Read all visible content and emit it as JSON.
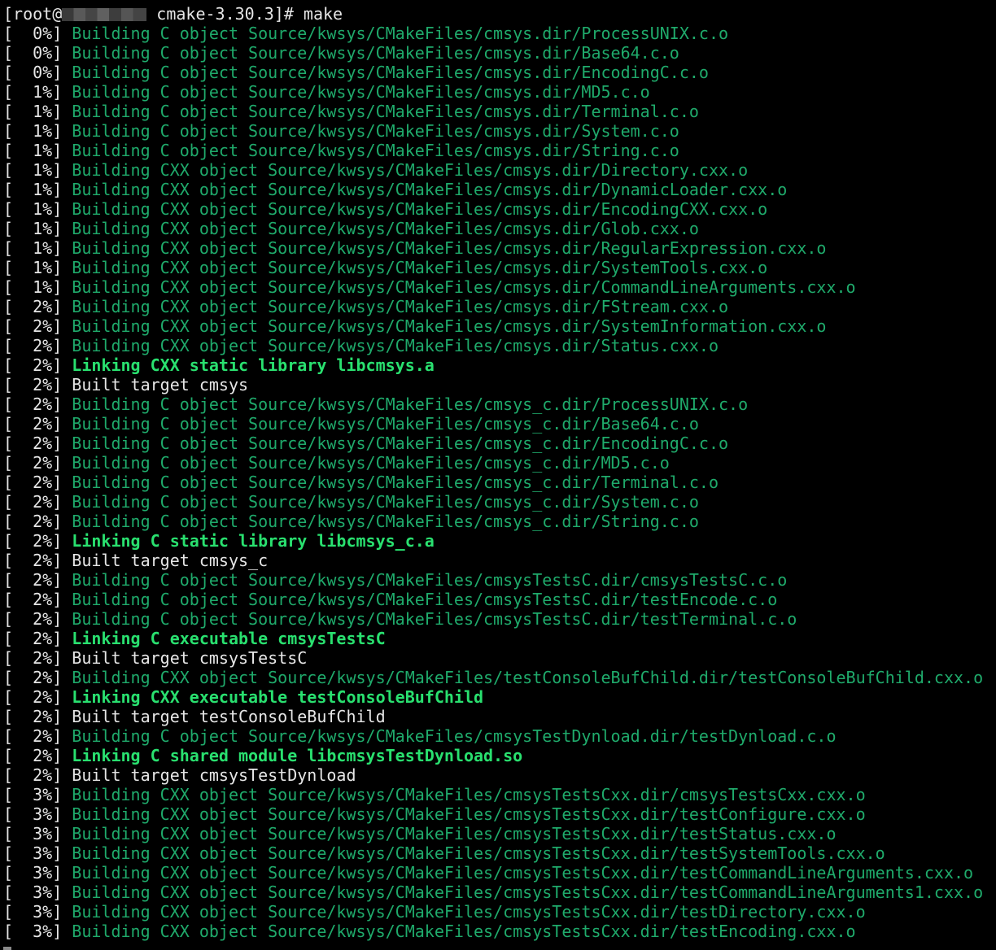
{
  "terminal": {
    "prompt": {
      "prefix": "[root@",
      "host_masked": "",
      "suffix": " cmake-3.30.3]# make"
    },
    "lines": [
      {
        "pct": "[  0%]",
        "msg": "Building C object Source/kwsys/CMakeFiles/cmsys.dir/ProcessUNIX.c.o",
        "kind": "build"
      },
      {
        "pct": "[  0%]",
        "msg": "Building C object Source/kwsys/CMakeFiles/cmsys.dir/Base64.c.o",
        "kind": "build"
      },
      {
        "pct": "[  0%]",
        "msg": "Building C object Source/kwsys/CMakeFiles/cmsys.dir/EncodingC.c.o",
        "kind": "build"
      },
      {
        "pct": "[  1%]",
        "msg": "Building C object Source/kwsys/CMakeFiles/cmsys.dir/MD5.c.o",
        "kind": "build"
      },
      {
        "pct": "[  1%]",
        "msg": "Building C object Source/kwsys/CMakeFiles/cmsys.dir/Terminal.c.o",
        "kind": "build"
      },
      {
        "pct": "[  1%]",
        "msg": "Building C object Source/kwsys/CMakeFiles/cmsys.dir/System.c.o",
        "kind": "build"
      },
      {
        "pct": "[  1%]",
        "msg": "Building C object Source/kwsys/CMakeFiles/cmsys.dir/String.c.o",
        "kind": "build"
      },
      {
        "pct": "[  1%]",
        "msg": "Building CXX object Source/kwsys/CMakeFiles/cmsys.dir/Directory.cxx.o",
        "kind": "build"
      },
      {
        "pct": "[  1%]",
        "msg": "Building CXX object Source/kwsys/CMakeFiles/cmsys.dir/DynamicLoader.cxx.o",
        "kind": "build"
      },
      {
        "pct": "[  1%]",
        "msg": "Building CXX object Source/kwsys/CMakeFiles/cmsys.dir/EncodingCXX.cxx.o",
        "kind": "build"
      },
      {
        "pct": "[  1%]",
        "msg": "Building CXX object Source/kwsys/CMakeFiles/cmsys.dir/Glob.cxx.o",
        "kind": "build"
      },
      {
        "pct": "[  1%]",
        "msg": "Building CXX object Source/kwsys/CMakeFiles/cmsys.dir/RegularExpression.cxx.o",
        "kind": "build"
      },
      {
        "pct": "[  1%]",
        "msg": "Building CXX object Source/kwsys/CMakeFiles/cmsys.dir/SystemTools.cxx.o",
        "kind": "build"
      },
      {
        "pct": "[  1%]",
        "msg": "Building CXX object Source/kwsys/CMakeFiles/cmsys.dir/CommandLineArguments.cxx.o",
        "kind": "build"
      },
      {
        "pct": "[  2%]",
        "msg": "Building CXX object Source/kwsys/CMakeFiles/cmsys.dir/FStream.cxx.o",
        "kind": "build"
      },
      {
        "pct": "[  2%]",
        "msg": "Building CXX object Source/kwsys/CMakeFiles/cmsys.dir/SystemInformation.cxx.o",
        "kind": "build"
      },
      {
        "pct": "[  2%]",
        "msg": "Building CXX object Source/kwsys/CMakeFiles/cmsys.dir/Status.cxx.o",
        "kind": "build"
      },
      {
        "pct": "[  2%]",
        "msg": "Linking CXX static library libcmsys.a",
        "kind": "link"
      },
      {
        "pct": "[  2%]",
        "msg": "Built target cmsys",
        "kind": "built"
      },
      {
        "pct": "[  2%]",
        "msg": "Building C object Source/kwsys/CMakeFiles/cmsys_c.dir/ProcessUNIX.c.o",
        "kind": "build"
      },
      {
        "pct": "[  2%]",
        "msg": "Building C object Source/kwsys/CMakeFiles/cmsys_c.dir/Base64.c.o",
        "kind": "build"
      },
      {
        "pct": "[  2%]",
        "msg": "Building C object Source/kwsys/CMakeFiles/cmsys_c.dir/EncodingC.c.o",
        "kind": "build"
      },
      {
        "pct": "[  2%]",
        "msg": "Building C object Source/kwsys/CMakeFiles/cmsys_c.dir/MD5.c.o",
        "kind": "build"
      },
      {
        "pct": "[  2%]",
        "msg": "Building C object Source/kwsys/CMakeFiles/cmsys_c.dir/Terminal.c.o",
        "kind": "build"
      },
      {
        "pct": "[  2%]",
        "msg": "Building C object Source/kwsys/CMakeFiles/cmsys_c.dir/System.c.o",
        "kind": "build"
      },
      {
        "pct": "[  2%]",
        "msg": "Building C object Source/kwsys/CMakeFiles/cmsys_c.dir/String.c.o",
        "kind": "build"
      },
      {
        "pct": "[  2%]",
        "msg": "Linking C static library libcmsys_c.a",
        "kind": "link"
      },
      {
        "pct": "[  2%]",
        "msg": "Built target cmsys_c",
        "kind": "built"
      },
      {
        "pct": "[  2%]",
        "msg": "Building C object Source/kwsys/CMakeFiles/cmsysTestsC.dir/cmsysTestsC.c.o",
        "kind": "build"
      },
      {
        "pct": "[  2%]",
        "msg": "Building C object Source/kwsys/CMakeFiles/cmsysTestsC.dir/testEncode.c.o",
        "kind": "build"
      },
      {
        "pct": "[  2%]",
        "msg": "Building C object Source/kwsys/CMakeFiles/cmsysTestsC.dir/testTerminal.c.o",
        "kind": "build"
      },
      {
        "pct": "[  2%]",
        "msg": "Linking C executable cmsysTestsC",
        "kind": "link"
      },
      {
        "pct": "[  2%]",
        "msg": "Built target cmsysTestsC",
        "kind": "built"
      },
      {
        "pct": "[  2%]",
        "msg": "Building CXX object Source/kwsys/CMakeFiles/testConsoleBufChild.dir/testConsoleBufChild.cxx.o",
        "kind": "build"
      },
      {
        "pct": "[  2%]",
        "msg": "Linking CXX executable testConsoleBufChild",
        "kind": "link"
      },
      {
        "pct": "[  2%]",
        "msg": "Built target testConsoleBufChild",
        "kind": "built"
      },
      {
        "pct": "[  2%]",
        "msg": "Building C object Source/kwsys/CMakeFiles/cmsysTestDynload.dir/testDynload.c.o",
        "kind": "build"
      },
      {
        "pct": "[  2%]",
        "msg": "Linking C shared module libcmsysTestDynload.so",
        "kind": "link"
      },
      {
        "pct": "[  2%]",
        "msg": "Built target cmsysTestDynload",
        "kind": "built"
      },
      {
        "pct": "[  3%]",
        "msg": "Building CXX object Source/kwsys/CMakeFiles/cmsysTestsCxx.dir/cmsysTestsCxx.cxx.o",
        "kind": "build"
      },
      {
        "pct": "[  3%]",
        "msg": "Building CXX object Source/kwsys/CMakeFiles/cmsysTestsCxx.dir/testConfigure.cxx.o",
        "kind": "build"
      },
      {
        "pct": "[  3%]",
        "msg": "Building CXX object Source/kwsys/CMakeFiles/cmsysTestsCxx.dir/testStatus.cxx.o",
        "kind": "build"
      },
      {
        "pct": "[  3%]",
        "msg": "Building CXX object Source/kwsys/CMakeFiles/cmsysTestsCxx.dir/testSystemTools.cxx.o",
        "kind": "build"
      },
      {
        "pct": "[  3%]",
        "msg": "Building CXX object Source/kwsys/CMakeFiles/cmsysTestsCxx.dir/testCommandLineArguments.cxx.o",
        "kind": "build"
      },
      {
        "pct": "[  3%]",
        "msg": "Building CXX object Source/kwsys/CMakeFiles/cmsysTestsCxx.dir/testCommandLineArguments1.cxx.o",
        "kind": "build"
      },
      {
        "pct": "[  3%]",
        "msg": "Building CXX object Source/kwsys/CMakeFiles/cmsysTestsCxx.dir/testDirectory.cxx.o",
        "kind": "build"
      },
      {
        "pct": "[  3%]",
        "msg": "Building CXX object Source/kwsys/CMakeFiles/cmsysTestsCxx.dir/testEncoding.cxx.o",
        "kind": "build"
      }
    ],
    "colors": {
      "background": "#000000",
      "default_text": "#e6e6e6",
      "build": "#1faa6b",
      "link": "#29e06f"
    }
  }
}
